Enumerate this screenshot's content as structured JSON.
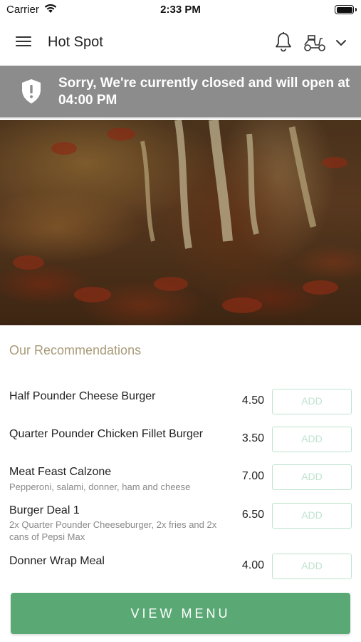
{
  "status_bar": {
    "carrier": "Carrier",
    "time": "2:33 PM"
  },
  "header": {
    "title": "Hot Spot",
    "icons": [
      "menu-icon",
      "bell-icon",
      "scooter-icon",
      "chevron-down-icon"
    ]
  },
  "closed_banner": {
    "message": "Sorry, We're currently closed and will open at 04:00 PM",
    "icon": "shield-alert-icon"
  },
  "hero": {
    "image": "pizza-cheese-pull"
  },
  "recommendations": {
    "heading": "Our Recommendations",
    "items": [
      {
        "name": "Half Pounder Cheese Burger",
        "description": "",
        "price": "4.50",
        "button": "ADD"
      },
      {
        "name": "Quarter Pounder Chicken Fillet Burger",
        "description": "",
        "price": "3.50",
        "button": "ADD"
      },
      {
        "name": "Meat Feast Calzone",
        "description": "Pepperoni, salami, donner, ham and cheese",
        "price": "7.00",
        "button": "ADD"
      },
      {
        "name": "Burger Deal 1",
        "description": "2x Quarter Pounder Cheeseburger, 2x fries and 2x cans of Pepsi Max",
        "price": "6.50",
        "button": "ADD"
      },
      {
        "name": "Donner Wrap Meal",
        "description": "",
        "price": "4.00",
        "button": "ADD"
      }
    ]
  },
  "footer": {
    "view_menu_label": "VIEW MENU"
  },
  "colors": {
    "accent_green": "#5aa975",
    "add_outline": "#bfe3cf",
    "banner_gray": "#8c8c8c",
    "heading_tan": "#a89a78"
  }
}
